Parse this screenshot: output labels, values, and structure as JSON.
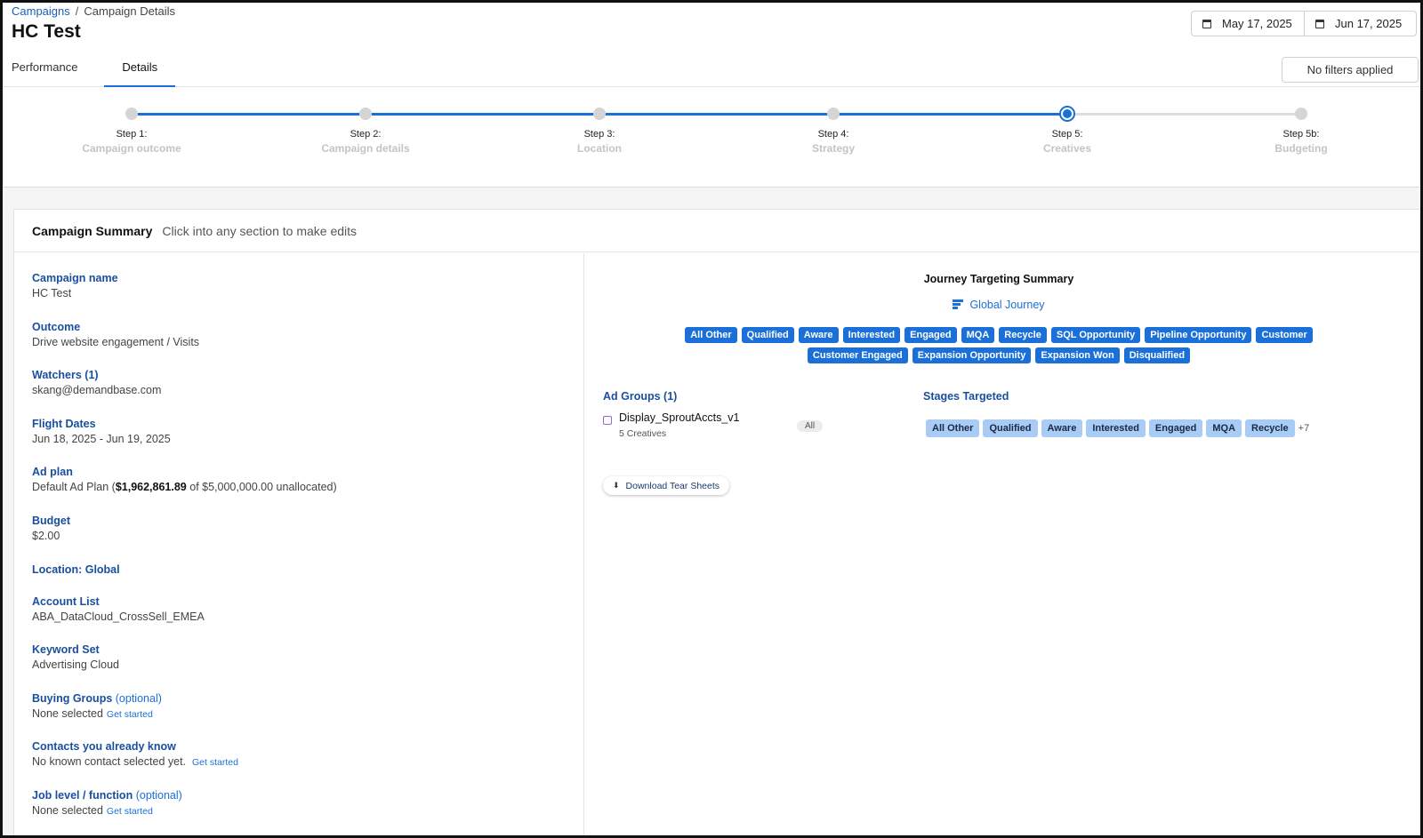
{
  "breadcrumb": {
    "root": "Campaigns",
    "separator": "/",
    "current": "Campaign Details"
  },
  "page_title": "HC Test",
  "tabs": [
    {
      "label": "Performance",
      "active": false
    },
    {
      "label": "Details",
      "active": true
    }
  ],
  "date_range": {
    "start": "May 17, 2025",
    "end": "Jun 17, 2025"
  },
  "filters_label": "No filters applied",
  "stepper": {
    "current_index": 4,
    "steps": [
      {
        "num": "Step 1:",
        "name": "Campaign outcome"
      },
      {
        "num": "Step 2:",
        "name": "Campaign details"
      },
      {
        "num": "Step 3:",
        "name": "Location"
      },
      {
        "num": "Step 4:",
        "name": "Strategy"
      },
      {
        "num": "Step 5:",
        "name": "Creatives"
      },
      {
        "num": "Step 5b:",
        "name": "Budgeting"
      }
    ]
  },
  "summary": {
    "title": "Campaign Summary",
    "hint": "Click into any section to make edits",
    "campaign_name_label": "Campaign name",
    "campaign_name": "HC Test",
    "outcome_label": "Outcome",
    "outcome": "Drive website engagement / Visits",
    "watchers_label": "Watchers (1)",
    "watchers": "skang@demandbase.com",
    "flight_label": "Flight Dates",
    "flight": "Jun 18, 2025 - Jun 19, 2025",
    "adplan_label": "Ad plan",
    "adplan_prefix": "Default Ad Plan (",
    "adplan_amount": "$1,962,861.89",
    "adplan_suffix": " of $5,000,000.00 unallocated)",
    "budget_label": "Budget",
    "budget": "$2.00",
    "location_label": "Location: Global",
    "account_list_label": "Account List",
    "account_list": "ABA_DataCloud_CrossSell_EMEA",
    "keyword_label": "Keyword Set",
    "keyword": "Advertising Cloud",
    "buying_groups_label": "Buying Groups",
    "optional": "(optional)",
    "buying_groups": "None selected",
    "contacts_label": "Contacts you already know",
    "contacts": "No known contact selected yet.",
    "job_label": "Job level / function",
    "job": "None selected",
    "get_started": "Get started"
  },
  "journey": {
    "title": "Journey Targeting Summary",
    "link": "Global Journey",
    "stages": [
      "All Other",
      "Qualified",
      "Aware",
      "Interested",
      "Engaged",
      "MQA",
      "Recycle",
      "SQL Opportunity",
      "Pipeline Opportunity",
      "Customer",
      "Customer Engaged",
      "Expansion Opportunity",
      "Expansion Won",
      "Disqualified"
    ]
  },
  "ad_groups": {
    "label": "Ad Groups (1)",
    "name": "Display_SproutAccts_v1",
    "sub": "5 Creatives",
    "badge": "All",
    "stages_label": "Stages Targeted",
    "stages": [
      "All Other",
      "Qualified",
      "Aware",
      "Interested",
      "Engaged",
      "MQA",
      "Recycle"
    ],
    "more": "+7",
    "download": "Download Tear Sheets"
  }
}
